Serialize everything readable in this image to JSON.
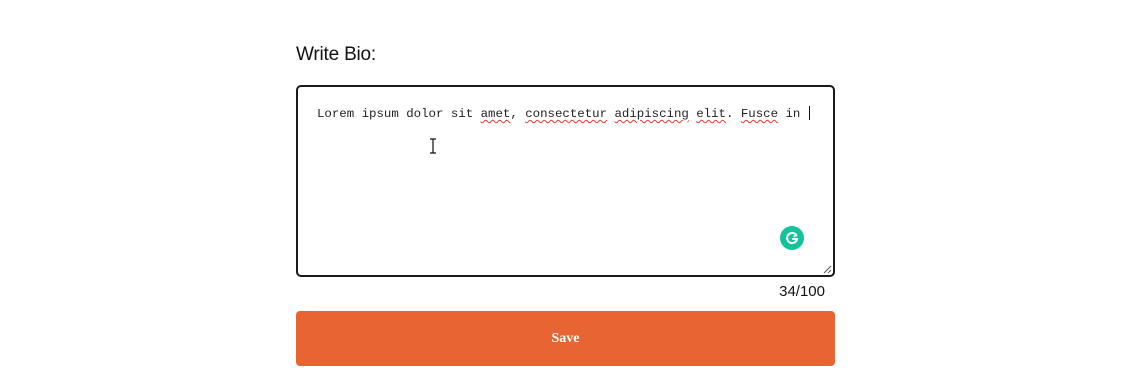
{
  "bio": {
    "label": "Write Bio:",
    "text_plain_1": "Lorem ipsum dolor sit ",
    "text_sq_1": "amet",
    "text_plain_2": ", ",
    "text_sq_2": "consectetur",
    "text_plain_3": " ",
    "text_sq_3": "adipiscing",
    "text_plain_4": " ",
    "text_sq_4": "elit",
    "text_plain_5": ". ",
    "text_sq_5": "Fusce",
    "text_plain_6": " in ",
    "char_count": "34/100"
  },
  "actions": {
    "save_label": "Save"
  },
  "colors": {
    "accent": "#e86433",
    "grammarly": "#15c39a",
    "spellcheck": "#e53935"
  },
  "icons": {
    "grammarly": "grammarly-icon",
    "cursor": "text-cursor-icon",
    "resize": "resize-handle-icon"
  }
}
